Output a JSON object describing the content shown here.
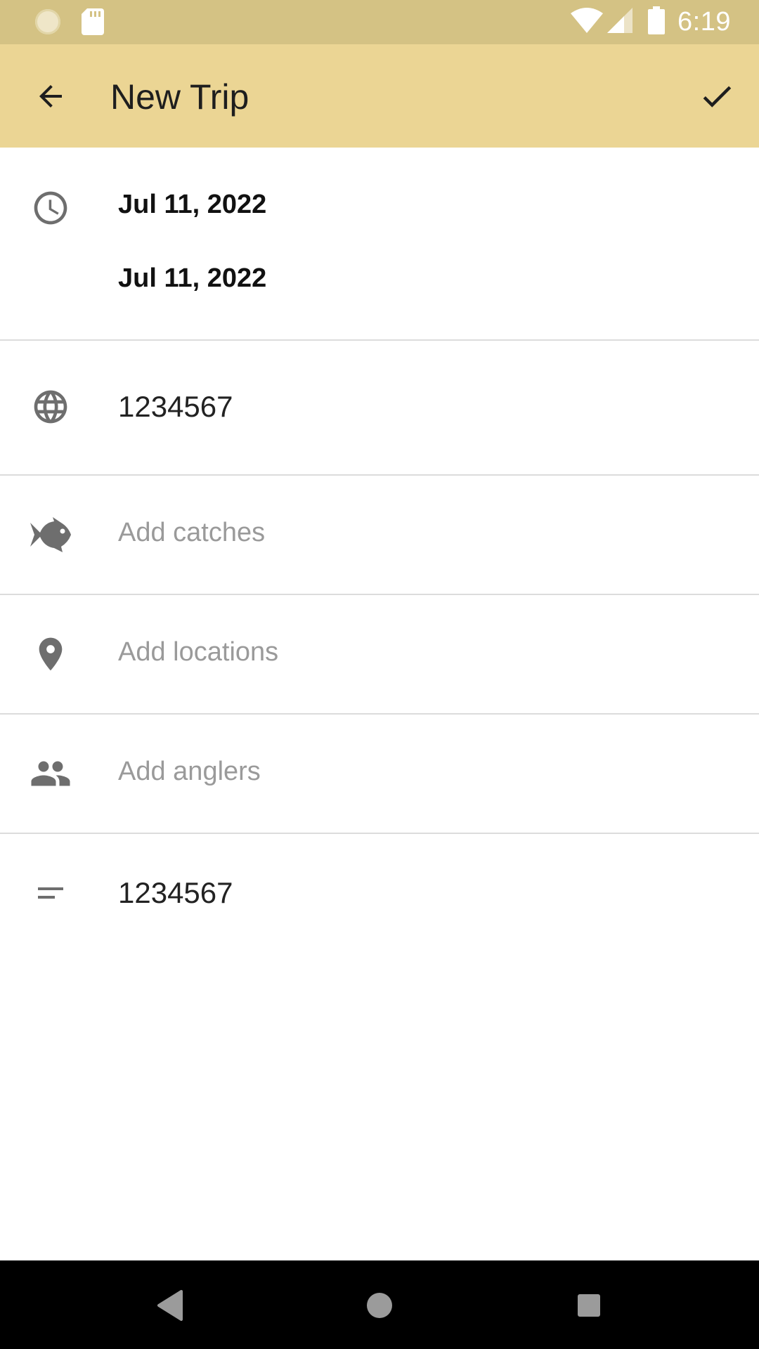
{
  "status_bar": {
    "time": "6:19",
    "icons": [
      "sync-icon",
      "sd-card-icon",
      "wifi-icon",
      "signal-icon",
      "battery-icon"
    ]
  },
  "app_bar": {
    "title": "New Trip",
    "back_icon": "arrow-back-icon",
    "save_icon": "check-icon",
    "background": "#ebd594"
  },
  "trip": {
    "start_date": "Jul 11, 2022",
    "end_date": "Jul 11, 2022",
    "atmosphere_value": "1234567",
    "catches_placeholder": "Add catches",
    "locations_placeholder": "Add locations",
    "anglers_placeholder": "Add anglers",
    "notes_value": "1234567"
  },
  "nav_bar": {
    "items": [
      "back-triangle-icon",
      "home-circle-icon",
      "recents-square-icon"
    ]
  }
}
